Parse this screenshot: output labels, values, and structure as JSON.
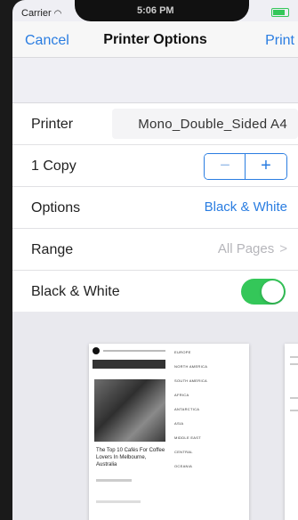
{
  "status": {
    "carrier": "Carrier",
    "time": "5:06 PM"
  },
  "nav": {
    "cancel": "Cancel",
    "title": "Printer Options",
    "print": "Print"
  },
  "rows": {
    "printer": {
      "label": "Printer",
      "value": "Mono_Double_Sided A4"
    },
    "copies": {
      "label": "1 Copy",
      "minus": "−",
      "plus": "+"
    },
    "options": {
      "label": "Options",
      "value": "Black & White"
    },
    "range": {
      "label": "Range",
      "value": "All Pages"
    },
    "bw": {
      "label": "Black & White",
      "on": true
    }
  },
  "preview": {
    "caption": "The Top 10 Cafés For Coffee Lovers In Melbourne, Australia",
    "menu": [
      "EUROPE",
      "NORTH AMERICA",
      "SOUTH AMERICA",
      "AFRICA",
      "ANTARCTICA",
      "ASIA",
      "MIDDLE EAST",
      "CENTRAL",
      "OCEANIA"
    ]
  },
  "colors": {
    "accent": "#2a7de1",
    "toggle_on": "#34c759"
  },
  "icons": {
    "wifi": "wifi-icon",
    "battery": "battery-icon",
    "chevron": "chevron-right-icon"
  }
}
